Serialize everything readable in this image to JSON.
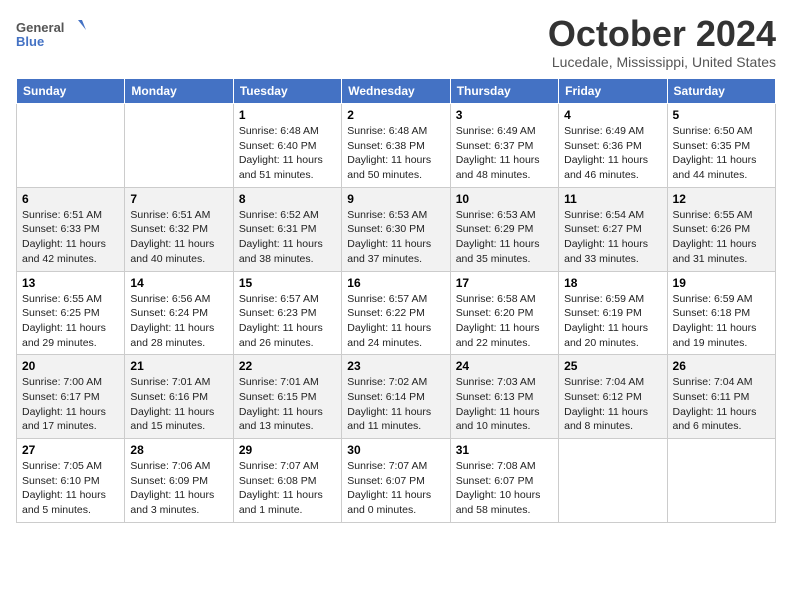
{
  "header": {
    "logo_line1": "General",
    "logo_line2": "Blue",
    "month_title": "October 2024",
    "location": "Lucedale, Mississippi, United States"
  },
  "weekdays": [
    "Sunday",
    "Monday",
    "Tuesday",
    "Wednesday",
    "Thursday",
    "Friday",
    "Saturday"
  ],
  "weeks": [
    [
      {
        "day": "",
        "content": ""
      },
      {
        "day": "",
        "content": ""
      },
      {
        "day": "1",
        "content": "Sunrise: 6:48 AM\nSunset: 6:40 PM\nDaylight: 11 hours and 51 minutes."
      },
      {
        "day": "2",
        "content": "Sunrise: 6:48 AM\nSunset: 6:38 PM\nDaylight: 11 hours and 50 minutes."
      },
      {
        "day": "3",
        "content": "Sunrise: 6:49 AM\nSunset: 6:37 PM\nDaylight: 11 hours and 48 minutes."
      },
      {
        "day": "4",
        "content": "Sunrise: 6:49 AM\nSunset: 6:36 PM\nDaylight: 11 hours and 46 minutes."
      },
      {
        "day": "5",
        "content": "Sunrise: 6:50 AM\nSunset: 6:35 PM\nDaylight: 11 hours and 44 minutes."
      }
    ],
    [
      {
        "day": "6",
        "content": "Sunrise: 6:51 AM\nSunset: 6:33 PM\nDaylight: 11 hours and 42 minutes."
      },
      {
        "day": "7",
        "content": "Sunrise: 6:51 AM\nSunset: 6:32 PM\nDaylight: 11 hours and 40 minutes."
      },
      {
        "day": "8",
        "content": "Sunrise: 6:52 AM\nSunset: 6:31 PM\nDaylight: 11 hours and 38 minutes."
      },
      {
        "day": "9",
        "content": "Sunrise: 6:53 AM\nSunset: 6:30 PM\nDaylight: 11 hours and 37 minutes."
      },
      {
        "day": "10",
        "content": "Sunrise: 6:53 AM\nSunset: 6:29 PM\nDaylight: 11 hours and 35 minutes."
      },
      {
        "day": "11",
        "content": "Sunrise: 6:54 AM\nSunset: 6:27 PM\nDaylight: 11 hours and 33 minutes."
      },
      {
        "day": "12",
        "content": "Sunrise: 6:55 AM\nSunset: 6:26 PM\nDaylight: 11 hours and 31 minutes."
      }
    ],
    [
      {
        "day": "13",
        "content": "Sunrise: 6:55 AM\nSunset: 6:25 PM\nDaylight: 11 hours and 29 minutes."
      },
      {
        "day": "14",
        "content": "Sunrise: 6:56 AM\nSunset: 6:24 PM\nDaylight: 11 hours and 28 minutes."
      },
      {
        "day": "15",
        "content": "Sunrise: 6:57 AM\nSunset: 6:23 PM\nDaylight: 11 hours and 26 minutes."
      },
      {
        "day": "16",
        "content": "Sunrise: 6:57 AM\nSunset: 6:22 PM\nDaylight: 11 hours and 24 minutes."
      },
      {
        "day": "17",
        "content": "Sunrise: 6:58 AM\nSunset: 6:20 PM\nDaylight: 11 hours and 22 minutes."
      },
      {
        "day": "18",
        "content": "Sunrise: 6:59 AM\nSunset: 6:19 PM\nDaylight: 11 hours and 20 minutes."
      },
      {
        "day": "19",
        "content": "Sunrise: 6:59 AM\nSunset: 6:18 PM\nDaylight: 11 hours and 19 minutes."
      }
    ],
    [
      {
        "day": "20",
        "content": "Sunrise: 7:00 AM\nSunset: 6:17 PM\nDaylight: 11 hours and 17 minutes."
      },
      {
        "day": "21",
        "content": "Sunrise: 7:01 AM\nSunset: 6:16 PM\nDaylight: 11 hours and 15 minutes."
      },
      {
        "day": "22",
        "content": "Sunrise: 7:01 AM\nSunset: 6:15 PM\nDaylight: 11 hours and 13 minutes."
      },
      {
        "day": "23",
        "content": "Sunrise: 7:02 AM\nSunset: 6:14 PM\nDaylight: 11 hours and 11 minutes."
      },
      {
        "day": "24",
        "content": "Sunrise: 7:03 AM\nSunset: 6:13 PM\nDaylight: 11 hours and 10 minutes."
      },
      {
        "day": "25",
        "content": "Sunrise: 7:04 AM\nSunset: 6:12 PM\nDaylight: 11 hours and 8 minutes."
      },
      {
        "day": "26",
        "content": "Sunrise: 7:04 AM\nSunset: 6:11 PM\nDaylight: 11 hours and 6 minutes."
      }
    ],
    [
      {
        "day": "27",
        "content": "Sunrise: 7:05 AM\nSunset: 6:10 PM\nDaylight: 11 hours and 5 minutes."
      },
      {
        "day": "28",
        "content": "Sunrise: 7:06 AM\nSunset: 6:09 PM\nDaylight: 11 hours and 3 minutes."
      },
      {
        "day": "29",
        "content": "Sunrise: 7:07 AM\nSunset: 6:08 PM\nDaylight: 11 hours and 1 minute."
      },
      {
        "day": "30",
        "content": "Sunrise: 7:07 AM\nSunset: 6:07 PM\nDaylight: 11 hours and 0 minutes."
      },
      {
        "day": "31",
        "content": "Sunrise: 7:08 AM\nSunset: 6:07 PM\nDaylight: 10 hours and 58 minutes."
      },
      {
        "day": "",
        "content": ""
      },
      {
        "day": "",
        "content": ""
      }
    ]
  ]
}
